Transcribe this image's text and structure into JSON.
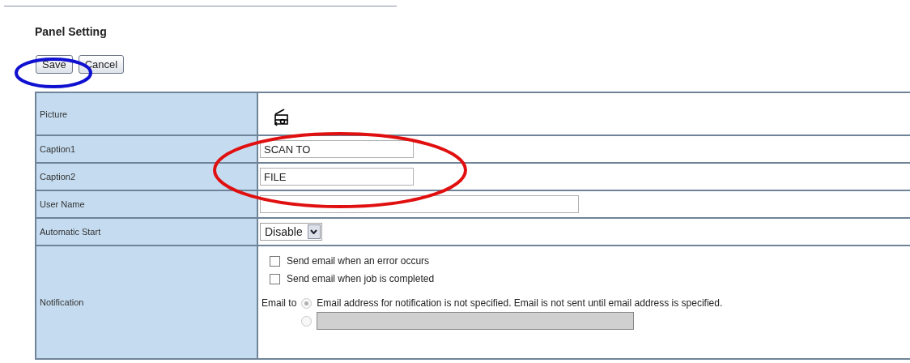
{
  "title": "Panel Setting",
  "buttons": [
    {
      "label": "Save"
    },
    {
      "label": "Cancel"
    }
  ],
  "rows": [
    {
      "label": "Picture",
      "kind": "picture"
    },
    {
      "label": "Caption1",
      "kind": "text",
      "value": "SCAN TO"
    },
    {
      "label": "Caption2",
      "kind": "text",
      "value": "FILE"
    },
    {
      "label": "User Name",
      "kind": "widetext"
    },
    {
      "label": "Automatic Start",
      "kind": "select",
      "value": "Disable"
    },
    {
      "label": "Notification",
      "kind": "notification"
    }
  ],
  "notification": {
    "checks": [
      {
        "label": "Send email when an error occurs",
        "checked": false
      },
      {
        "label": "Send email when job is completed",
        "checked": false
      }
    ],
    "email_label": "Email to",
    "options": [
      {
        "kind": "message",
        "text": "Email address for notification is not specified. Email is not sent until email address is specified.",
        "selected": true
      },
      {
        "kind": "field",
        "selected": false,
        "disabled": true
      }
    ]
  },
  "annotations": [
    {
      "kind": "ellipse",
      "color": "#1010d0"
    },
    {
      "kind": "ellipse",
      "color": "#e01010"
    }
  ]
}
